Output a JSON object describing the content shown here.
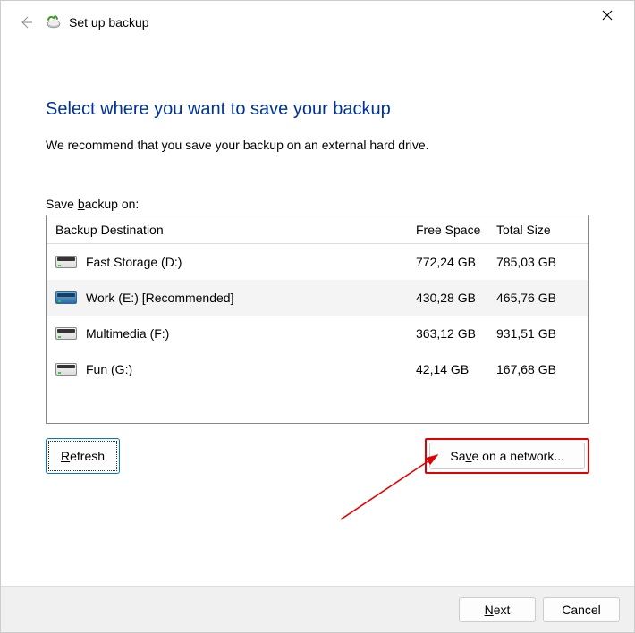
{
  "titlebar": {
    "title": "Set up backup"
  },
  "main": {
    "heading": "Select where you want to save your backup",
    "subtext": "We recommend that you save your backup on an external hard drive.",
    "save_label_pre": "Save ",
    "save_label_ul": "b",
    "save_label_post": "ackup on:",
    "columns": {
      "dest": "Backup Destination",
      "free": "Free Space",
      "total": "Total Size"
    },
    "drives": [
      {
        "name": "Fast Storage (D:)",
        "free": "772,24 GB",
        "total": "785,03 GB",
        "color": "gray",
        "selected": false
      },
      {
        "name": "Work (E:) [Recommended]",
        "free": "430,28 GB",
        "total": "465,76 GB",
        "color": "blue",
        "selected": true
      },
      {
        "name": "Multimedia (F:)",
        "free": "363,12 GB",
        "total": "931,51 GB",
        "color": "gray",
        "selected": false
      },
      {
        "name": "Fun (G:)",
        "free": "42,14 GB",
        "total": "167,68 GB",
        "color": "gray",
        "selected": false
      }
    ],
    "refresh_ul": "R",
    "refresh_post": "efresh",
    "network_pre": "Sa",
    "network_ul": "v",
    "network_post": "e on a network..."
  },
  "footer": {
    "next_ul": "N",
    "next_post": "ext",
    "cancel": "Cancel"
  }
}
